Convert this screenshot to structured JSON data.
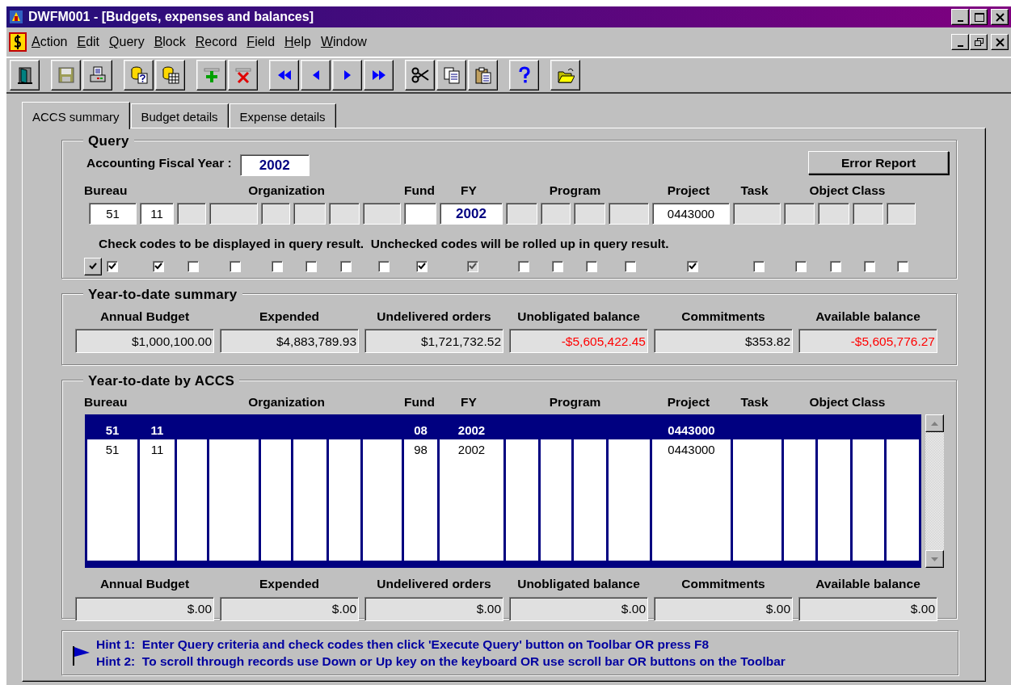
{
  "window": {
    "title": "DWFM001 - [Budgets, expenses and balances]"
  },
  "menu": [
    "Action",
    "Edit",
    "Query",
    "Block",
    "Record",
    "Field",
    "Help",
    "Window"
  ],
  "toolbar": [
    {
      "kind": "exit",
      "disabled": false
    },
    {
      "kind": "save",
      "disabled": true
    },
    {
      "kind": "print",
      "disabled": false
    },
    {
      "kind": "enter_query",
      "disabled": false
    },
    {
      "kind": "execute_query",
      "disabled": false
    },
    {
      "kind": "insert",
      "disabled": false
    },
    {
      "kind": "delete",
      "disabled": false
    },
    {
      "kind": "first",
      "disabled": false
    },
    {
      "kind": "previous",
      "disabled": false
    },
    {
      "kind": "next",
      "disabled": false
    },
    {
      "kind": "last",
      "disabled": false
    },
    {
      "kind": "cut",
      "disabled": false
    },
    {
      "kind": "copy",
      "disabled": false
    },
    {
      "kind": "paste",
      "disabled": false
    },
    {
      "kind": "help",
      "disabled": false
    },
    {
      "kind": "open",
      "disabled": false
    }
  ],
  "tabs": [
    {
      "label": "ACCS summary",
      "selected": true
    },
    {
      "label": "Budget details",
      "selected": false
    },
    {
      "label": "Expense details",
      "selected": false
    }
  ],
  "query": {
    "title": "Query",
    "fiscal_year_label": "Accounting Fiscal Year :",
    "fiscal_year": "2002",
    "error_report_button": "Error Report",
    "headers": [
      "Bureau",
      "Organization",
      "Fund",
      "FY",
      "Program",
      "Project",
      "Task",
      "Object Class"
    ],
    "fields": [
      {
        "value": "51",
        "disabled": false
      },
      {
        "value": "11",
        "disabled": false
      },
      {
        "disabled": true
      },
      {
        "disabled": true
      },
      {
        "disabled": true
      },
      {
        "disabled": true
      },
      {
        "disabled": true
      },
      {
        "disabled": true
      },
      {
        "disabled": false
      },
      {
        "value": "2002",
        "disabled": false
      },
      {
        "disabled": true
      },
      {
        "disabled": true
      },
      {
        "disabled": true
      },
      {
        "disabled": true
      },
      {
        "value": "0443000",
        "disabled": false
      },
      {
        "disabled": true
      },
      {
        "disabled": true
      },
      {
        "disabled": true
      },
      {
        "disabled": true
      },
      {
        "disabled": true
      }
    ],
    "instruction": "Check codes to be displayed in query result.  Unchecked codes will be rolled up in query result.",
    "checkboxes": [
      {
        "checked": true,
        "disabled": false
      },
      {
        "checked": true,
        "disabled": false
      },
      {
        "checked": false,
        "disabled": false
      },
      {
        "checked": false,
        "disabled": false
      },
      {
        "checked": false,
        "disabled": false
      },
      {
        "checked": false,
        "disabled": false
      },
      {
        "checked": false,
        "disabled": false
      },
      {
        "checked": false,
        "disabled": false
      },
      {
        "checked": true,
        "disabled": false
      },
      {
        "checked": true,
        "disabled": true
      },
      {
        "checked": false,
        "disabled": false
      },
      {
        "checked": false,
        "disabled": false
      },
      {
        "checked": false,
        "disabled": false
      },
      {
        "checked": false,
        "disabled": false
      },
      {
        "checked": true,
        "disabled": false
      },
      {
        "checked": false,
        "disabled": false
      },
      {
        "checked": false,
        "disabled": false
      },
      {
        "checked": false,
        "disabled": false
      },
      {
        "checked": false,
        "disabled": false
      },
      {
        "checked": false,
        "disabled": false
      }
    ]
  },
  "summary": {
    "title": "Year-to-date summary",
    "items": [
      {
        "label": "Annual Budget",
        "value": "$1,000,100.00",
        "negative": false
      },
      {
        "label": "Expended",
        "value": "$4,883,789.93",
        "negative": false
      },
      {
        "label": "Undelivered orders",
        "value": "$1,721,732.52",
        "negative": false
      },
      {
        "label": "Unobligated balance",
        "value": "-$5,605,422.45",
        "negative": true
      },
      {
        "label": "Commitments",
        "value": "$353.82",
        "negative": false
      },
      {
        "label": "Available balance",
        "value": "-$5,605,776.27",
        "negative": true
      }
    ]
  },
  "accs": {
    "title": "Year-to-date by ACCS",
    "headers": [
      "Bureau",
      "Organization",
      "Fund",
      "FY",
      "Program",
      "Project",
      "Task",
      "Object Class"
    ],
    "rows": [
      {
        "bureau": "51",
        "bureau_2": "11",
        "fund": "08",
        "fy": "2002",
        "project": "0443000",
        "selected": true
      },
      {
        "bureau": "51",
        "bureau_2": "11",
        "fund": "98",
        "fy": "2002",
        "project": "0443000",
        "selected": false
      }
    ],
    "totals": [
      {
        "label": "Annual Budget",
        "value": "$.00"
      },
      {
        "label": "Expended",
        "value": "$.00"
      },
      {
        "label": "Undelivered orders",
        "value": "$.00"
      },
      {
        "label": "Unobligated balance",
        "value": "$.00"
      },
      {
        "label": "Commitments",
        "value": "$.00"
      },
      {
        "label": "Available balance",
        "value": "$.00"
      }
    ]
  },
  "hints": [
    "Hint 1:  Enter Query criteria and check codes then click 'Execute Query' button on Toolbar OR press F8",
    "Hint 2:  To scroll through records use Down or Up key on the keyboard OR use scroll bar OR buttons on the Toolbar"
  ]
}
